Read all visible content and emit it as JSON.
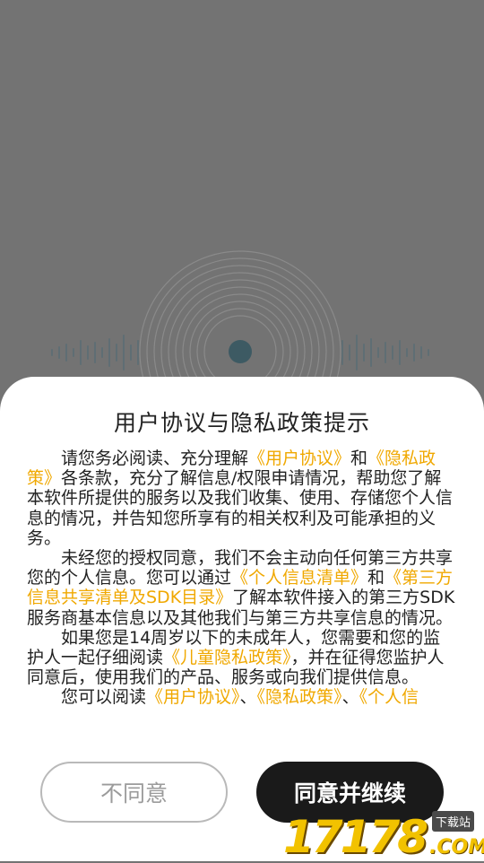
{
  "dialog": {
    "title": "用户协议与隐私政策提示",
    "paragraphs": [
      [
        {
          "text": "请您务必阅读、充分理解",
          "link": false
        },
        {
          "text": "《用户协议》",
          "link": true
        },
        {
          "text": "和",
          "link": false
        },
        {
          "text": "《隐私政策》",
          "link": true
        },
        {
          "text": "各条款，充分了解信息/权限申请情况，帮助您了解本软件所提供的服务以及我们收集、使用、存储您个人信息的情况，并告知您所享有的相关权利及可能承担的义务。",
          "link": false
        }
      ],
      [
        {
          "text": "未经您的授权同意，我们不会主动向任何第三方共享您的个人信息。您可以通过",
          "link": false
        },
        {
          "text": "《个人信息清单》",
          "link": true
        },
        {
          "text": "和",
          "link": false
        },
        {
          "text": "《第三方信息共享清单及SDK目录》",
          "link": true
        },
        {
          "text": "了解本软件接入的第三方SDK服务商基本信息以及其他我们与第三方共享信息的情况。",
          "link": false
        }
      ],
      [
        {
          "text": "如果您是14周岁以下的未成年人，您需要和您的监护人一起仔细阅读",
          "link": false
        },
        {
          "text": "《儿童隐私政策》",
          "link": true
        },
        {
          "text": "，并在征得您监护人同意后，使用我们的产品、服务或向我们提供信息。",
          "link": false
        }
      ],
      [
        {
          "text": "您可以阅读",
          "link": false
        },
        {
          "text": "《用户协议》",
          "link": true
        },
        {
          "text": "、",
          "link": false
        },
        {
          "text": "《隐私政策》",
          "link": true
        },
        {
          "text": "、",
          "link": false
        },
        {
          "text": "《个人信",
          "link": true
        }
      ]
    ],
    "disagree_label": "不同意",
    "agree_label": "同意并继续"
  },
  "watermark": {
    "number": "17178",
    "domain": ".COM",
    "tag": "下载站"
  },
  "colors": {
    "link": "#f0a800",
    "background_dim": "#737373",
    "agree_button": "#1a1a1a"
  }
}
